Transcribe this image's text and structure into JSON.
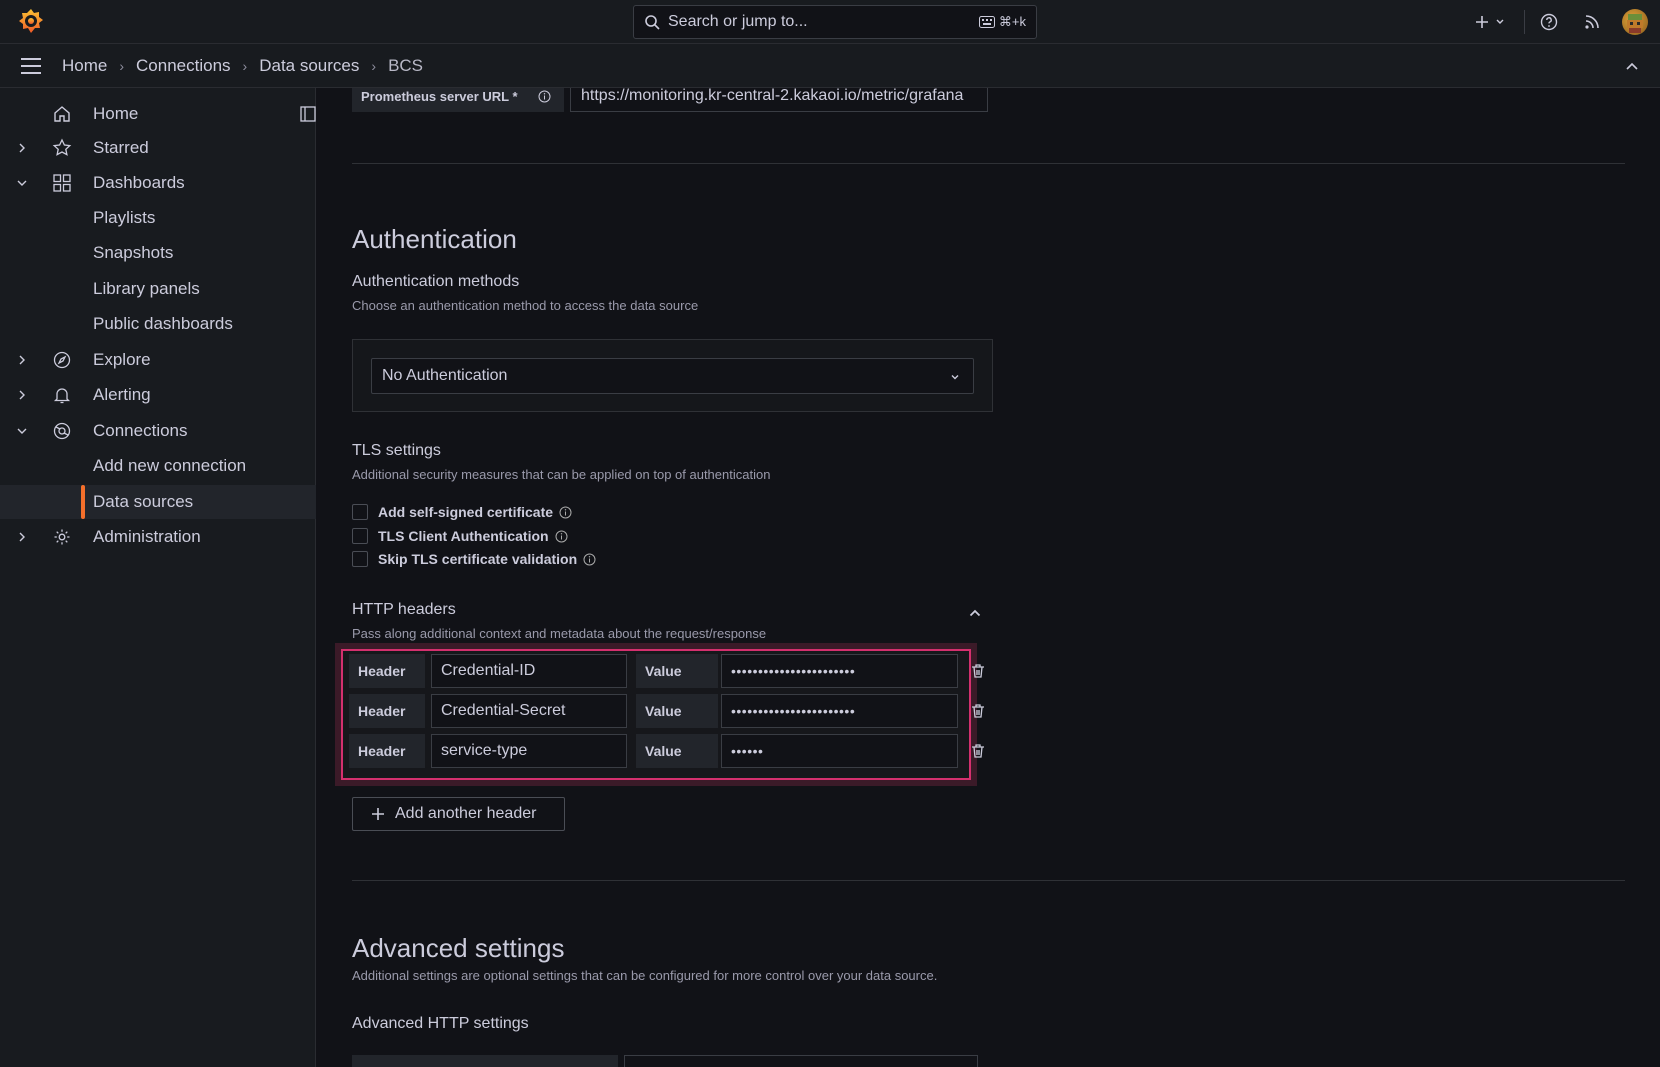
{
  "topbar": {
    "search_placeholder": "Search or jump to...",
    "search_shortcut": "⌘+k"
  },
  "breadcrumb": {
    "items": [
      "Home",
      "Connections",
      "Data sources",
      "BCS"
    ]
  },
  "sidebar": {
    "items": [
      {
        "label": "Home"
      },
      {
        "label": "Starred"
      },
      {
        "label": "Dashboards"
      },
      {
        "label": "Playlists"
      },
      {
        "label": "Snapshots"
      },
      {
        "label": "Library panels"
      },
      {
        "label": "Public dashboards"
      },
      {
        "label": "Explore"
      },
      {
        "label": "Alerting"
      },
      {
        "label": "Connections"
      },
      {
        "label": "Add new connection"
      },
      {
        "label": "Data sources"
      },
      {
        "label": "Administration"
      }
    ]
  },
  "connection": {
    "url_label": "Prometheus server URL *",
    "url_value": "https://monitoring.kr-central-2.kakaoi.io/metric/grafana"
  },
  "authentication": {
    "title": "Authentication",
    "methods_title": "Authentication methods",
    "methods_desc": "Choose an authentication method to access the data source",
    "selected_method": "No Authentication"
  },
  "tls": {
    "title": "TLS settings",
    "desc": "Additional security measures that can be applied on top of authentication",
    "options": [
      {
        "label": "Add self-signed certificate"
      },
      {
        "label": "TLS Client Authentication"
      },
      {
        "label": "Skip TLS certificate validation"
      }
    ]
  },
  "http_headers": {
    "title": "HTTP headers",
    "desc": "Pass along additional context and metadata about the request/response",
    "header_label": "Header",
    "value_label": "Value",
    "rows": [
      {
        "header": "Credential-ID",
        "value": "•••••••••••••••••••••••"
      },
      {
        "header": "Credential-Secret",
        "value": "•••••••••••••••••••••••"
      },
      {
        "header": "service-type",
        "value": "••••••"
      }
    ],
    "add_label": "Add another header"
  },
  "advanced": {
    "title": "Advanced settings",
    "desc": "Additional settings are optional settings that can be configured for more control over your data source.",
    "http_title": "Advanced HTTP settings"
  },
  "colors": {
    "accent": "#f46f2b",
    "highlight_border": "#d4306e",
    "background": "#111217",
    "panel": "#181b1f"
  }
}
